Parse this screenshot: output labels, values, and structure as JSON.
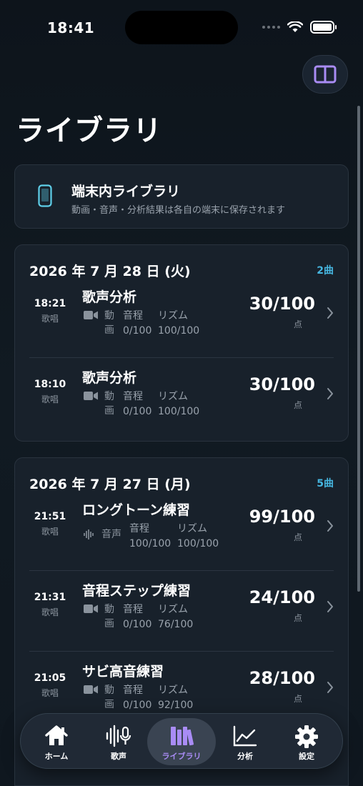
{
  "status": {
    "time": "18:41"
  },
  "page": {
    "title": "ライブラリ"
  },
  "info": {
    "title": "端末内ライブラリ",
    "subtitle": "動画・音声・分析結果は各自の端末に保存されます"
  },
  "groups": [
    {
      "date": "2026 年 7 月 28 日 (火)",
      "count": "2曲",
      "entries": [
        {
          "time": "18:21",
          "kind": "歌唱",
          "title": "歌声分析",
          "media": "動画",
          "pitch_label": "音程",
          "pitch": "0/100",
          "rhythm_label": "リズム",
          "rhythm": "100/100",
          "score": "30/100",
          "unit": "点"
        },
        {
          "time": "18:10",
          "kind": "歌唱",
          "title": "歌声分析",
          "media": "動画",
          "pitch_label": "音程",
          "pitch": "0/100",
          "rhythm_label": "リズム",
          "rhythm": "100/100",
          "score": "30/100",
          "unit": "点"
        }
      ]
    },
    {
      "date": "2026 年 7 月 27 日 (月)",
      "count": "5曲",
      "entries": [
        {
          "time": "21:51",
          "kind": "歌唱",
          "title": "ロングトーン練習",
          "media": "音声",
          "pitch_label": "音程",
          "pitch": "100/100",
          "rhythm_label": "リズム",
          "rhythm": "100/100",
          "score": "99/100",
          "unit": "点"
        },
        {
          "time": "21:31",
          "kind": "歌唱",
          "title": "音程ステップ練習",
          "media": "動画",
          "pitch_label": "音程",
          "pitch": "0/100",
          "rhythm_label": "リズム",
          "rhythm": "76/100",
          "score": "24/100",
          "unit": "点"
        },
        {
          "time": "21:05",
          "kind": "歌唱",
          "title": "サビ高音練習",
          "media": "動画",
          "pitch_label": "音程",
          "pitch": "0/100",
          "rhythm_label": "リズム",
          "rhythm": "92/100",
          "score": "28/100",
          "unit": "点"
        }
      ]
    }
  ],
  "tabs": [
    {
      "label": "ホーム",
      "icon": "home-icon"
    },
    {
      "label": "歌声",
      "icon": "voice-icon"
    },
    {
      "label": "ライブラリ",
      "icon": "library-icon",
      "active": true
    },
    {
      "label": "分析",
      "icon": "chart-icon"
    },
    {
      "label": "設定",
      "icon": "gear-icon"
    }
  ],
  "colors": {
    "accent": "#a98cf5",
    "count": "#46b6e0",
    "phone": "#5fd0ea"
  }
}
